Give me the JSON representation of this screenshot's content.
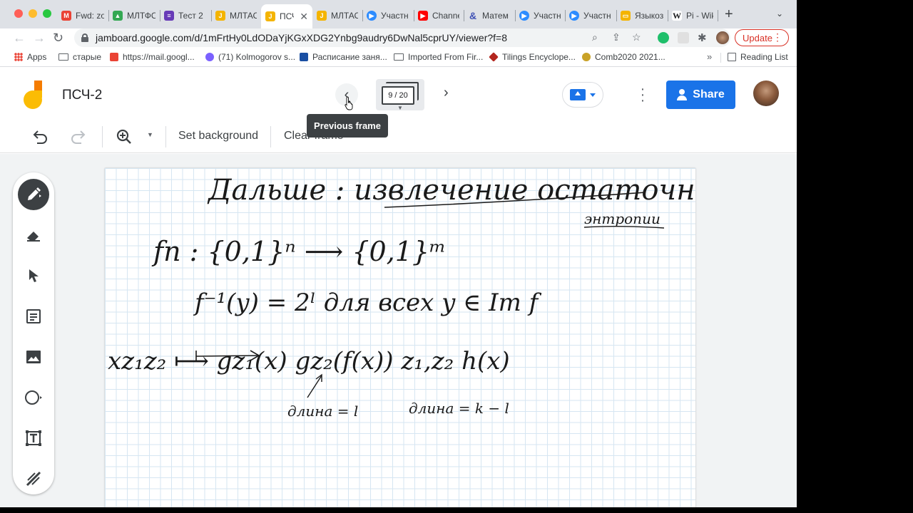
{
  "tabs": [
    {
      "title": "Fwd: zo",
      "icon": "gmail-icon",
      "color": "#ea4335"
    },
    {
      "title": "МЛТФС",
      "icon": "drive-icon",
      "color": "#34a853"
    },
    {
      "title": "Тест 2",
      "icon": "forms-icon",
      "color": "#673ab7"
    },
    {
      "title": "МЛТАС",
      "icon": "jamboard-icon",
      "color": "#f4b400"
    },
    {
      "title": "ПСЧ",
      "icon": "jamboard-icon",
      "color": "#f4b400"
    },
    {
      "title": "МЛТАС",
      "icon": "jamboard-icon",
      "color": "#f4b400"
    },
    {
      "title": "Участн",
      "icon": "zoom-icon",
      "color": "#2d8cff"
    },
    {
      "title": "Channe",
      "icon": "youtube-icon",
      "color": "#ff0000"
    },
    {
      "title": "Матем",
      "icon": "ampersand-icon",
      "color": "#3f51b5"
    },
    {
      "title": "Участн",
      "icon": "zoom-icon",
      "color": "#2d8cff"
    },
    {
      "title": "Участн",
      "icon": "zoom-icon",
      "color": "#2d8cff"
    },
    {
      "title": "Языкоз",
      "icon": "slides-icon",
      "color": "#f4b400"
    },
    {
      "title": "Pi - Wik",
      "icon": "wikipedia-icon",
      "color": "#202124"
    }
  ],
  "address": {
    "url": "jamboard.google.com/d/1mFrtHy0LdODaYjKGxXDG2Ynbg9audry6DwNal5cprUY/viewer?f=8"
  },
  "update_label": "Update",
  "bookmarks": {
    "apps": "Apps",
    "items": [
      "старые",
      "https://mail.googl...",
      "(71) Kolmogorov s...",
      "Расписание заня...",
      "Imported From Fir...",
      "Tilings Encyclope...",
      "Comb2020 2021..."
    ],
    "reading_list": "Reading List"
  },
  "jam": {
    "title": "ПСЧ-2",
    "frame_counter": "9 / 20",
    "share_label": "Share",
    "tooltip": "Previous frame",
    "toolbar": {
      "set_background": "Set background",
      "clear_frame": "Clear frame"
    }
  },
  "board": {
    "line1": "Дальше : извлечение остаточной",
    "line1b": "энтропии",
    "line2": "fn : {0,1}ⁿ ⟶ {0,1}ᵐ",
    "line3": "f⁻¹(y) = 2ˡ для всех y ∈ Im f",
    "line4": "xz₁z₂ ⟼ gz₁(x) gz₂(f(x)) z₁,z₂ h(x)",
    "line5a": "длина = l",
    "line5b": "длина = k − l"
  }
}
